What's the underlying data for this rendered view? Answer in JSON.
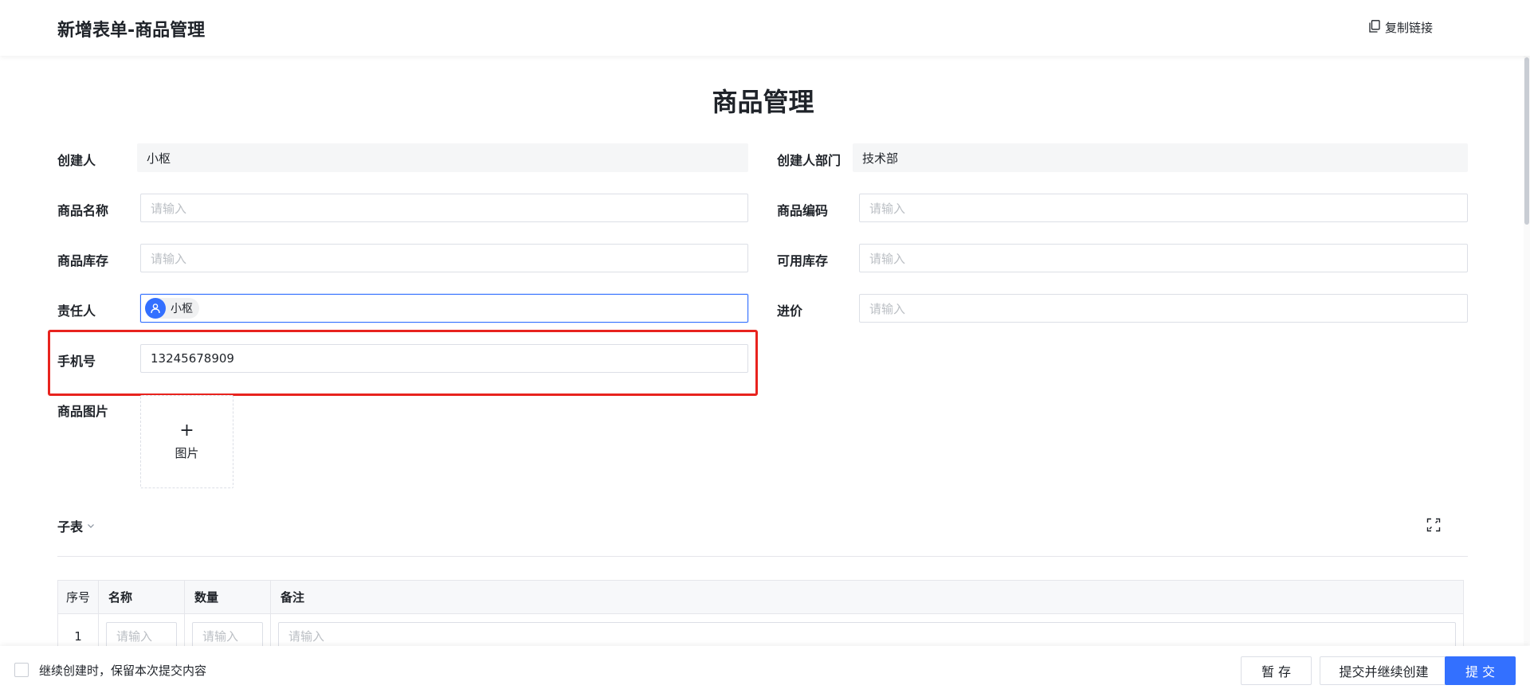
{
  "header": {
    "title": "新增表单-商品管理",
    "copy_link_label": "复制链接"
  },
  "form": {
    "title": "商品管理",
    "fields": {
      "creator": {
        "label": "创建人",
        "value": "小枢"
      },
      "creator_dept": {
        "label": "创建人部门",
        "value": "技术部"
      },
      "product_name": {
        "label": "商品名称",
        "placeholder": "请输入"
      },
      "product_code": {
        "label": "商品编码",
        "placeholder": "请输入"
      },
      "product_stock": {
        "label": "商品库存",
        "placeholder": "请输入"
      },
      "available_stock": {
        "label": "可用库存",
        "placeholder": "请输入"
      },
      "owner": {
        "label": "责任人",
        "value": "小枢"
      },
      "purchase_price": {
        "label": "进价",
        "placeholder": "请输入"
      },
      "phone": {
        "label": "手机号",
        "value": "13245678909"
      },
      "product_image": {
        "label": "商品图片",
        "upload_plus": "+",
        "upload_label": "图片"
      }
    }
  },
  "subtable": {
    "title": "子表",
    "columns": [
      "序号",
      "名称",
      "数量",
      "备注"
    ],
    "rows": [
      {
        "seq": "1",
        "name_placeholder": "请输入",
        "qty_placeholder": "请输入",
        "note_placeholder": "请输入"
      }
    ]
  },
  "footer": {
    "keep_label": "继续创建时，保留本次提交内容",
    "save_draft": "暂 存",
    "submit_continue": "提交并继续创建",
    "submit": "提 交"
  },
  "colors": {
    "accent": "#3370ff",
    "highlight": "#e8231e"
  },
  "icons": [
    "copy-icon",
    "user-icon",
    "chevron-down-icon",
    "expand-icon",
    "plus-icon"
  ]
}
